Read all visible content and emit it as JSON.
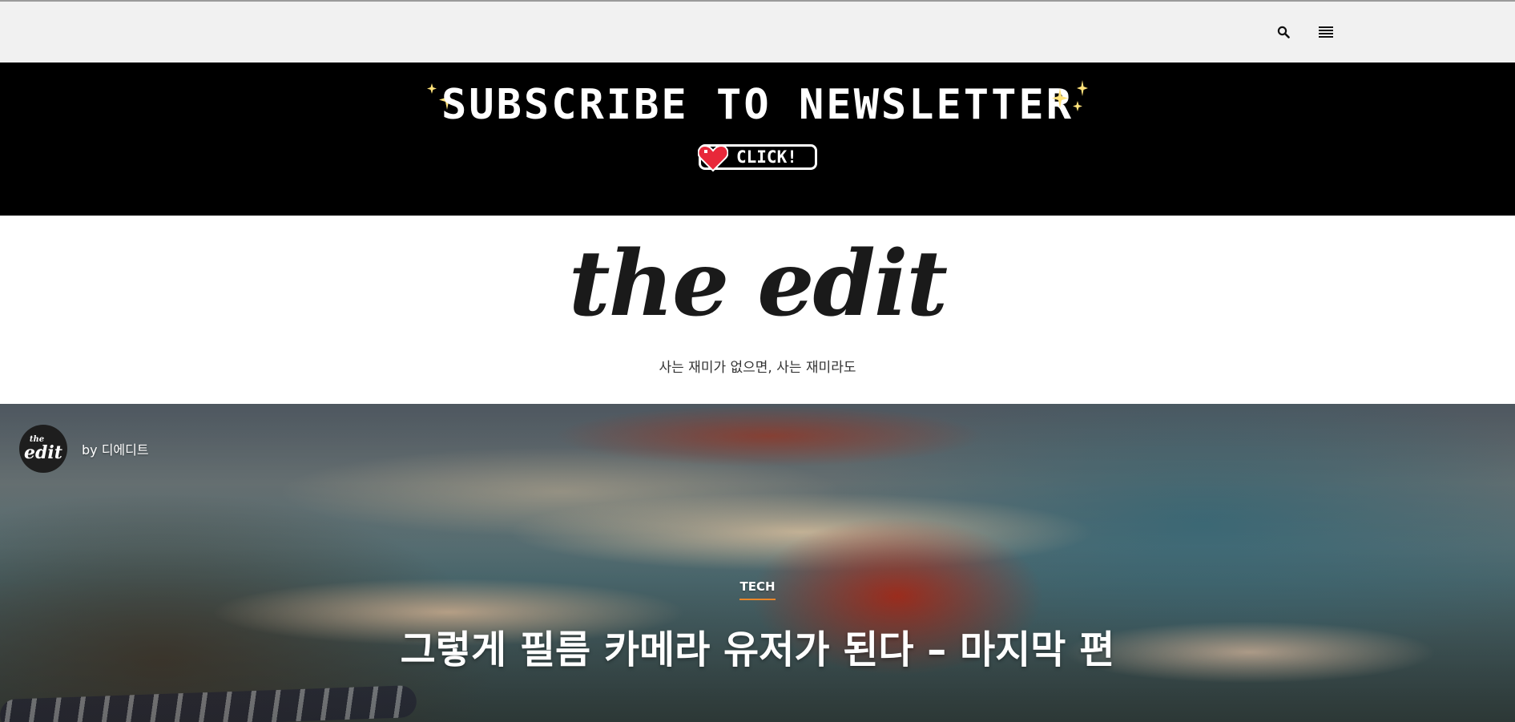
{
  "header": {
    "search_icon": "search-icon",
    "menu_icon": "hamburger-menu-icon"
  },
  "banner": {
    "title": "SUBSCRIBE TO NEWSLETTER",
    "button_label": "CLICK!",
    "background": "#000000",
    "accent": "#ffe27a",
    "heart_color": "#e8283a"
  },
  "site": {
    "logo": "the edit",
    "tagline": "사는 재미가 없으면, 사는 재미라도"
  },
  "hero": {
    "author_avatar_top": "the",
    "author_avatar_main": "edit",
    "author": "by 디에디트",
    "category": "TECH",
    "category_underline_color": "#e8862a",
    "title": "그렇게 필름 카메라 유저가 된다 – 마지막 편"
  }
}
